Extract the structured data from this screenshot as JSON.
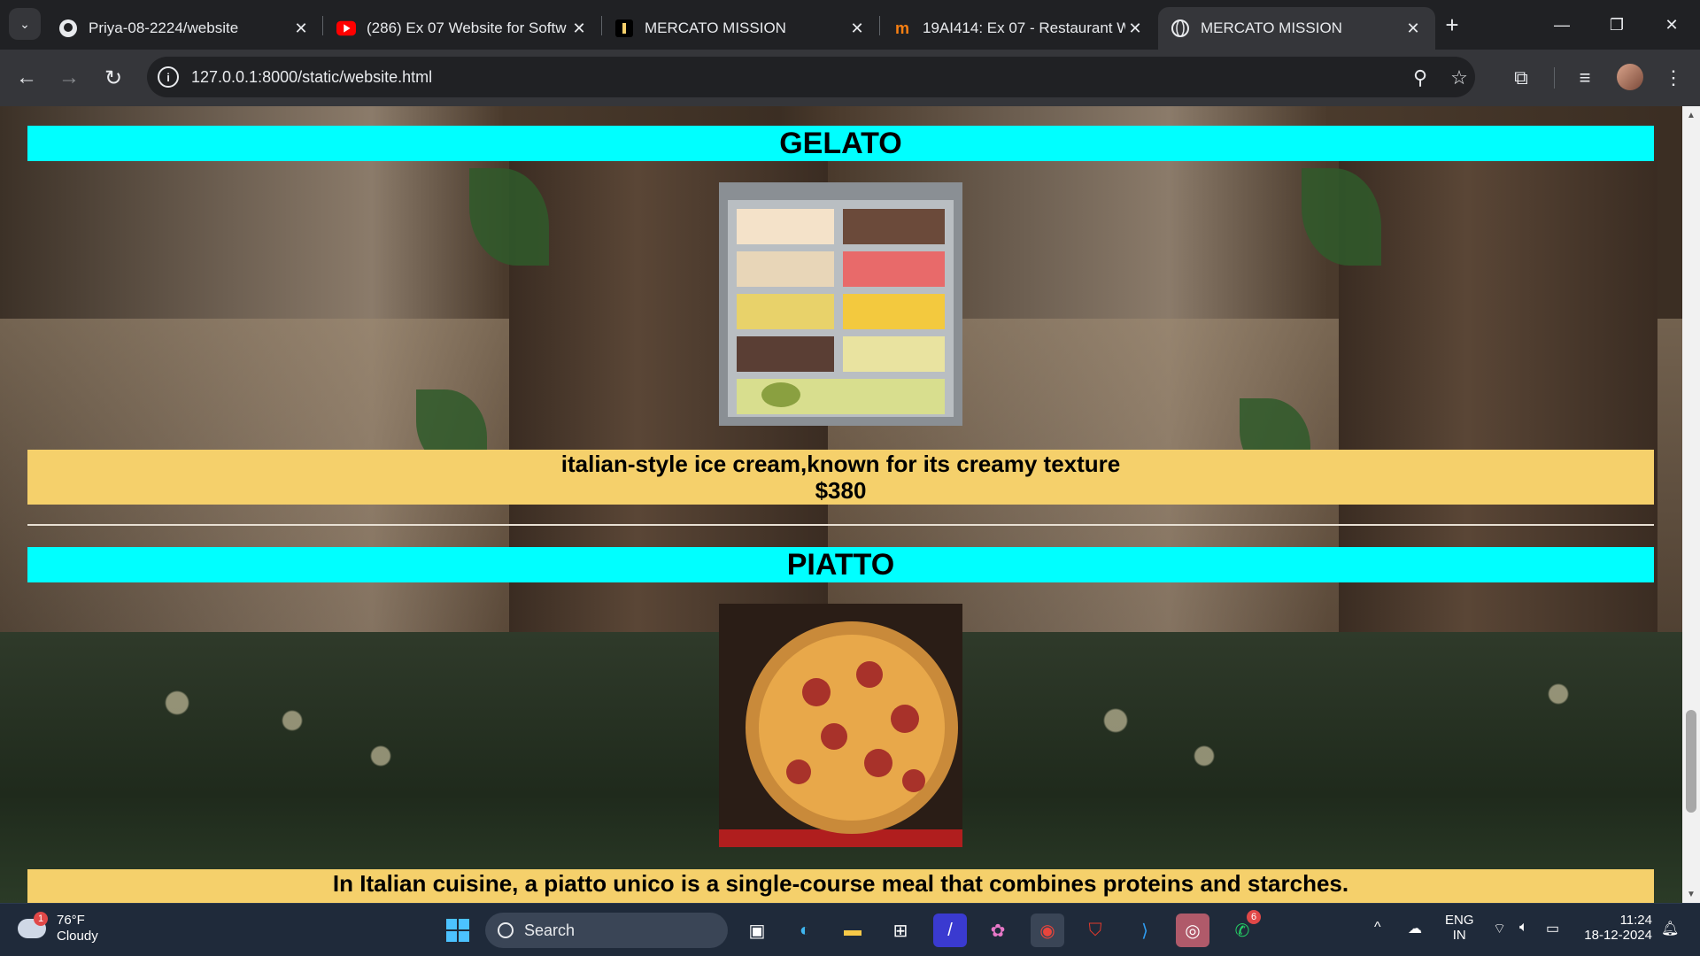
{
  "browser": {
    "tabs": [
      {
        "title": "Priya-08-2224/website",
        "icon": "github-icon",
        "active": false
      },
      {
        "title": "(286) Ex 07 Website for Softw",
        "icon": "youtube-icon",
        "active": false
      },
      {
        "title": "MERCATO MISSION",
        "icon": "site-icon",
        "active": false
      },
      {
        "title": "19AI414: Ex 07 - Restaurant W",
        "icon": "moodle-icon",
        "active": false
      },
      {
        "title": "MERCATO MISSION",
        "icon": "globe-icon",
        "active": true
      }
    ],
    "url": "127.0.0.1:8000/static/website.html"
  },
  "page": {
    "sections": [
      {
        "category": "GELATO",
        "image": "gelato-display-image",
        "description": "italian-style ice cream,known for its creamy texture",
        "price": "$380"
      },
      {
        "category": "PIATTO",
        "image": "pepperoni-pizza-image",
        "description": "In Italian cuisine, a piatto unico is a single-course meal that combines proteins and starches.",
        "price": ""
      }
    ],
    "colors": {
      "category_bar": "#00ffff",
      "description_box": "#f5d06b"
    }
  },
  "taskbar": {
    "weather_temp": "76°F",
    "weather_desc": "Cloudy",
    "weather_badge": "1",
    "search_label": "Search",
    "whatsapp_badge": "6",
    "lang_line1": "ENG",
    "lang_line2": "IN",
    "time": "11:24",
    "date": "18-12-2024"
  }
}
